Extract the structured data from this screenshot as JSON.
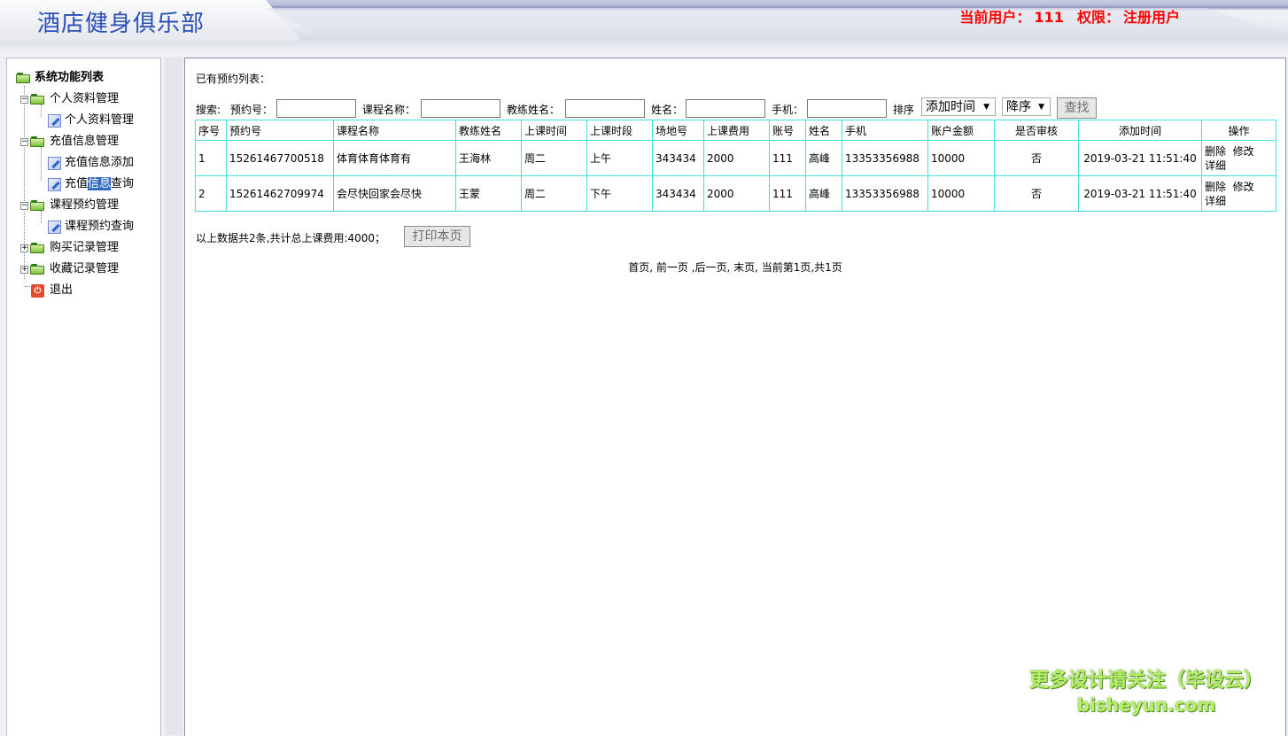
{
  "header": {
    "site_title": "酒店健身俱乐部",
    "user_label": "当前用户：",
    "user_name": "111",
    "role_label": "权限：",
    "role_value": "注册用户"
  },
  "sidebar": {
    "root": "系统功能列表",
    "groups": [
      {
        "label": "个人资料管理",
        "expanded": true,
        "items": [
          "个人资料管理"
        ]
      },
      {
        "label": "充值信息管理",
        "expanded": true,
        "items": [
          "充值信息添加",
          "充值"
        ]
      },
      {
        "label": "课程预约管理",
        "expanded": true,
        "items": [
          "课程预约查询"
        ]
      },
      {
        "label": "购买记录管理",
        "expanded": false,
        "items": []
      },
      {
        "label": "收藏记录管理",
        "expanded": false,
        "items": []
      }
    ],
    "selected_part": "信息",
    "selected_rest": "查询",
    "exit": "退出"
  },
  "main": {
    "list_title": "已有预约列表：",
    "search": {
      "label": "搜索:",
      "f1": "预约号：",
      "f2": "课程名称：",
      "f3": "教练姓名：",
      "f4": "姓名：",
      "f5": "手机：",
      "sort_label": "排序",
      "sort_field": "添加时间",
      "sort_order": "降序",
      "find_button": "查找"
    },
    "table": {
      "headers": [
        "序号",
        "预约号",
        "课程名称",
        "教练姓名",
        "上课时间",
        "上课时段",
        "场地号",
        "上课费用",
        "账号",
        "姓名",
        "手机",
        "账户金额",
        "是否审核",
        "添加时间",
        "操作"
      ],
      "rows": [
        [
          "1",
          "15261467700518",
          "体育体育体育有",
          "王海林",
          "周二",
          "上午",
          "343434",
          "2000",
          "111",
          "高峰",
          "13353356988",
          "10000",
          "否",
          "2019-03-21 11:51:40"
        ],
        [
          "2",
          "15261462709974",
          "会尽快回家会尽快",
          "王蒙",
          "周二",
          "下午",
          "343434",
          "2000",
          "111",
          "高峰",
          "13353356988",
          "10000",
          "否",
          "2019-03-21 11:51:40"
        ]
      ],
      "op_delete": "删除",
      "op_edit": "修改",
      "op_detail": "详细"
    },
    "summary": "以上数据共2条,共计总上课费用:4000；",
    "print_button": "打印本页",
    "pager": "首页, 前一页 ,后一页, 末页, 当前第1页,共1页"
  },
  "watermark": {
    "line1": "更多设计请关注（毕设云）",
    "line2": "bisheyun.com"
  },
  "colors": {
    "title_blue": "#2a4fb8",
    "user_red": "#ff0000",
    "grid_border": "#40e0e0",
    "watermark_green": "#b7ef6a"
  }
}
